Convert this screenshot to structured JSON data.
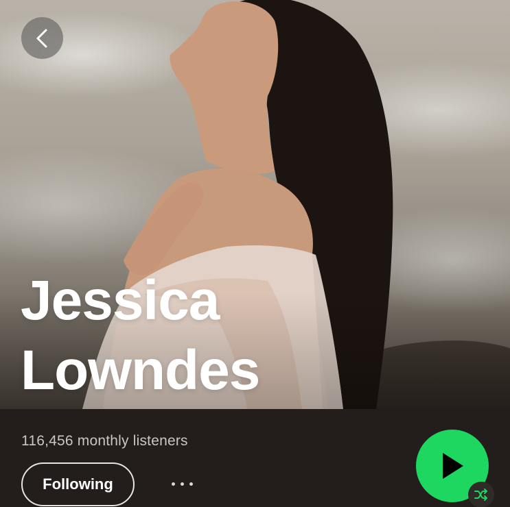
{
  "artist": {
    "name_line1": "Jessica",
    "name_line2": "Lowndes",
    "monthly_listeners": "116,456 monthly listeners"
  },
  "actions": {
    "follow_label": "Following",
    "more_icon": "more-dots-icon",
    "play_icon": "play-icon",
    "shuffle_icon": "shuffle-icon",
    "back_icon": "chevron-left-icon"
  },
  "colors": {
    "accent_green": "#1ed760",
    "background": "#231e1b",
    "text_primary": "#ffffff",
    "text_secondary": "#c9c6c3"
  }
}
